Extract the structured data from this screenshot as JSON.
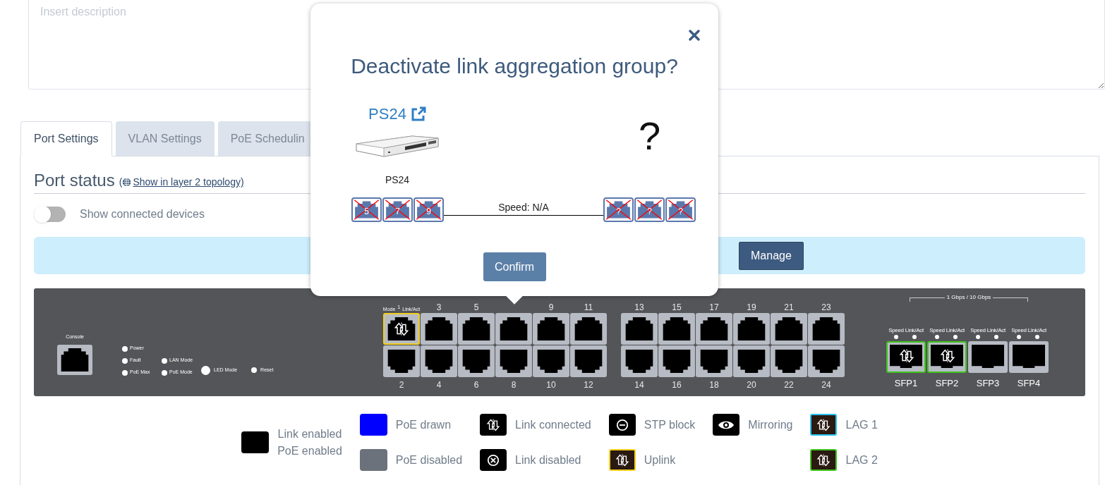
{
  "description": {
    "placeholder": "Insert description"
  },
  "tabs": [
    {
      "label": "Port Settings",
      "selected": true
    },
    {
      "label": "VLAN Settings",
      "selected": false
    },
    {
      "label": "PoE Schedulin",
      "selected": false
    }
  ],
  "port_status": {
    "title": "Port status",
    "prefix": "(",
    "link": "Show in layer 2 topology)"
  },
  "show_connected_devices": {
    "label": "Show connected devices",
    "on": false
  },
  "info_bar": {
    "button": "Manage"
  },
  "switch_panel": {
    "console": "Console",
    "status_leds": [
      [
        "Power",
        "Fault",
        "PoE Max"
      ],
      [
        "LAN Mode",
        "PoE Mode"
      ]
    ],
    "buttons": [
      {
        "label": "LED Mode",
        "kind": "large"
      },
      {
        "label": "Reset",
        "kind": "small"
      }
    ],
    "port_header": [
      "Mode",
      "Link/Act"
    ],
    "port_groups": [
      [
        {
          "top": {
            "label": "1",
            "kind": "uplink"
          },
          "bottom": {
            "label": "2",
            "kind": "plain"
          }
        },
        {
          "top": {
            "label": "3",
            "kind": "plain"
          },
          "bottom": {
            "label": "4",
            "kind": "plain"
          }
        },
        {
          "top": {
            "label": "5",
            "kind": "plain"
          },
          "bottom": {
            "label": "6",
            "kind": "plain"
          }
        },
        {
          "top": {
            "kind": "plain"
          },
          "bottom": {
            "label": "8",
            "kind": "plain"
          }
        },
        {
          "top": {
            "label": "9",
            "kind": "plain"
          },
          "bottom": {
            "label": "10",
            "kind": "plain"
          }
        },
        {
          "top": {
            "label": "11",
            "kind": "plain"
          },
          "bottom": {
            "label": "12",
            "kind": "plain"
          }
        }
      ],
      [
        {
          "top": {
            "label": "13",
            "kind": "plain"
          },
          "bottom": {
            "label": "14",
            "kind": "plain"
          }
        },
        {
          "top": {
            "label": "15",
            "kind": "plain"
          },
          "bottom": {
            "label": "16",
            "kind": "plain"
          }
        },
        {
          "top": {
            "label": "17",
            "kind": "plain"
          },
          "bottom": {
            "label": "18",
            "kind": "plain"
          }
        },
        {
          "top": {
            "label": "19",
            "kind": "plain"
          },
          "bottom": {
            "label": "20",
            "kind": "plain"
          }
        },
        {
          "top": {
            "label": "21",
            "kind": "plain"
          },
          "bottom": {
            "label": "22",
            "kind": "plain"
          }
        },
        {
          "top": {
            "label": "23",
            "kind": "plain"
          },
          "bottom": {
            "label": "24",
            "kind": "plain"
          }
        }
      ]
    ],
    "sfp_group": "1 Gbps / 10 Gbps",
    "sfp_ports": [
      {
        "label": "SFP1",
        "leds": [
          "Speed",
          "Link/Act"
        ],
        "kind": "lag2"
      },
      {
        "label": "SFP2",
        "leds": [
          "Speed",
          "Link/Act"
        ],
        "kind": "lag2"
      },
      {
        "label": "SFP3",
        "leds": [
          "Speed",
          "Link/Act"
        ],
        "kind": "plain"
      },
      {
        "label": "SFP4",
        "leds": [
          "Speed",
          "Link/Act"
        ],
        "kind": "plain"
      }
    ]
  },
  "legend": [
    [
      {
        "kind": "swatch",
        "color": "#000000",
        "labels": [
          "Link enabled",
          "PoE enabled"
        ]
      }
    ],
    [
      {
        "kind": "swatch",
        "color": "#0000ff",
        "labels": [
          "PoE drawn"
        ]
      },
      {
        "kind": "swatch",
        "color": "#6c727c",
        "labels": [
          "PoE disabled"
        ]
      }
    ],
    [
      {
        "kind": "link",
        "labels": [
          "Link connected"
        ]
      },
      {
        "kind": "link_disabled",
        "labels": [
          "Link disabled"
        ]
      }
    ],
    [
      {
        "kind": "stp_block",
        "labels": [
          "STP block"
        ]
      },
      {
        "kind": "framed_link",
        "color": "#f2cf1d",
        "labels": [
          "Uplink"
        ]
      }
    ],
    [
      {
        "kind": "mirroring",
        "labels": [
          "Mirroring"
        ]
      }
    ],
    [
      {
        "kind": "framed_link",
        "color": "#29c0ef",
        "labels": [
          "LAG 1"
        ]
      },
      {
        "kind": "framed_link",
        "color": "#3fc41d",
        "labels": [
          "LAG 2"
        ]
      }
    ]
  ],
  "modal": {
    "title": "Deactivate link aggregation group?",
    "device": {
      "link": "PS24",
      "name": "PS24"
    },
    "unknown_device": "?",
    "local_ports": [
      {
        "label": "5",
        "disabled": true
      },
      {
        "label": "7",
        "disabled": true
      },
      {
        "label": "9",
        "disabled": true
      }
    ],
    "speed": "Speed: N/A",
    "remote_ports": [
      {
        "label": "?",
        "disabled": true
      },
      {
        "label": "?",
        "disabled": true
      },
      {
        "label": "?",
        "disabled": true
      }
    ],
    "confirm": "Confirm"
  }
}
